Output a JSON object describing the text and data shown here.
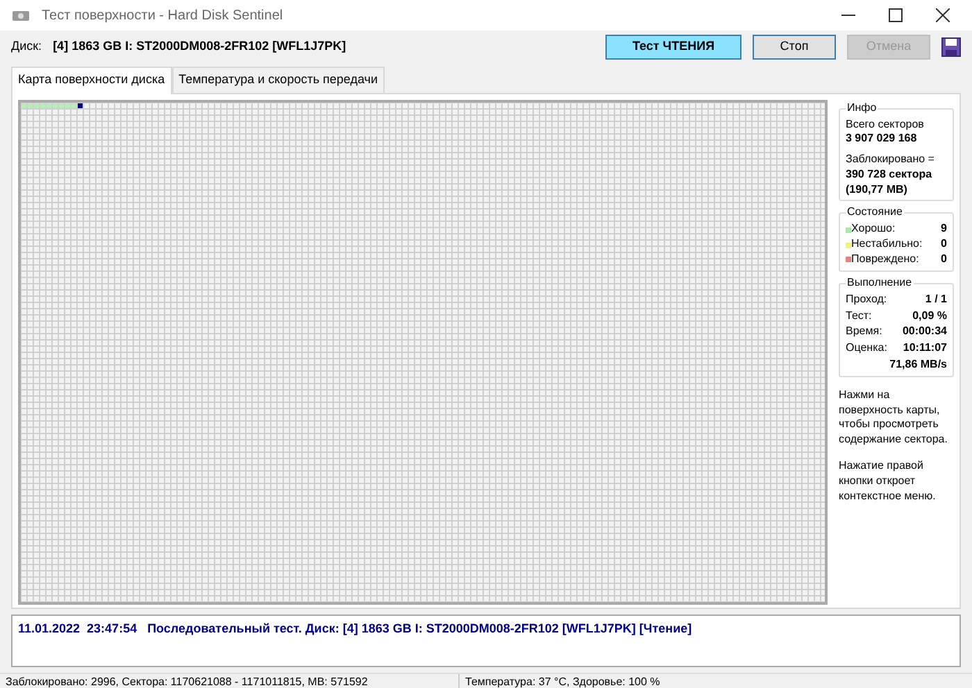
{
  "window": {
    "title": "Тест поверхности - Hard Disk Sentinel"
  },
  "toolbar": {
    "disk_label": "Диск:",
    "disk_name": "[4] 1863 GB I: ST2000DM008-2FR102 [WFL1J7PK]",
    "buttons": [
      {
        "label": "Тест ЧТЕНИЯ",
        "kind": "mode",
        "disabled": false
      },
      {
        "label": "Стоп",
        "kind": "normal",
        "disabled": false
      },
      {
        "label": "Отмена",
        "kind": "normal",
        "disabled": true
      }
    ]
  },
  "tabs": [
    {
      "label": "Карта поверхности диска",
      "selected": true
    },
    {
      "label": "Температура и скорость передачи",
      "selected": false
    }
  ],
  "surface_map": {
    "blocks": [
      {
        "kind": "good"
      },
      {
        "kind": "good"
      },
      {
        "kind": "good"
      },
      {
        "kind": "good"
      },
      {
        "kind": "good"
      },
      {
        "kind": "good"
      },
      {
        "kind": "good"
      },
      {
        "kind": "good"
      },
      {
        "kind": "good"
      },
      {
        "kind": "current"
      }
    ]
  },
  "info": {
    "title": "Инфо",
    "total_label": "Всего секторов",
    "total_value": "3 907 029 168",
    "blocked_label": "Заблокировано =",
    "blocked_value": "390 728 сектора",
    "blocked_size": "(190,77 MB)"
  },
  "state": {
    "title": "Состояние",
    "items": [
      {
        "label": "Хорошо:",
        "value": "9",
        "color": "#a8e8a8"
      },
      {
        "label": "Нестабильно:",
        "value": "0",
        "color": "#f0f080"
      },
      {
        "label": "Повреждено:",
        "value": "0",
        "color": "#f08080"
      }
    ]
  },
  "progress": {
    "title": "Выполнение",
    "rows": [
      {
        "label": "Проход:",
        "value": "1 / 1"
      },
      {
        "label": "Тест:",
        "value": "0,09 %"
      },
      {
        "label": "Время:",
        "value": "00:00:34"
      },
      {
        "label": "Оценка:",
        "value": "10:11:07"
      }
    ],
    "speed": "71,86 MB/s"
  },
  "hints": [
    "Нажми на поверхность карты, чтобы просмотреть содержание сектора.",
    "Нажатие правой кнопки откроет контекстное меню."
  ],
  "log": [
    "11.01.2022  23:47:54   Последовательный тест. Диск: [4] 1863 GB I: ST2000DM008-2FR102 [WFL1J7PK] [Чтение]"
  ],
  "status_bar": [
    "Заблокировано: 2996, Сектора: 1170621088 - 1171011815, MB: 571592",
    "Температура: 37  °C,  Здоровье: 100 %"
  ]
}
